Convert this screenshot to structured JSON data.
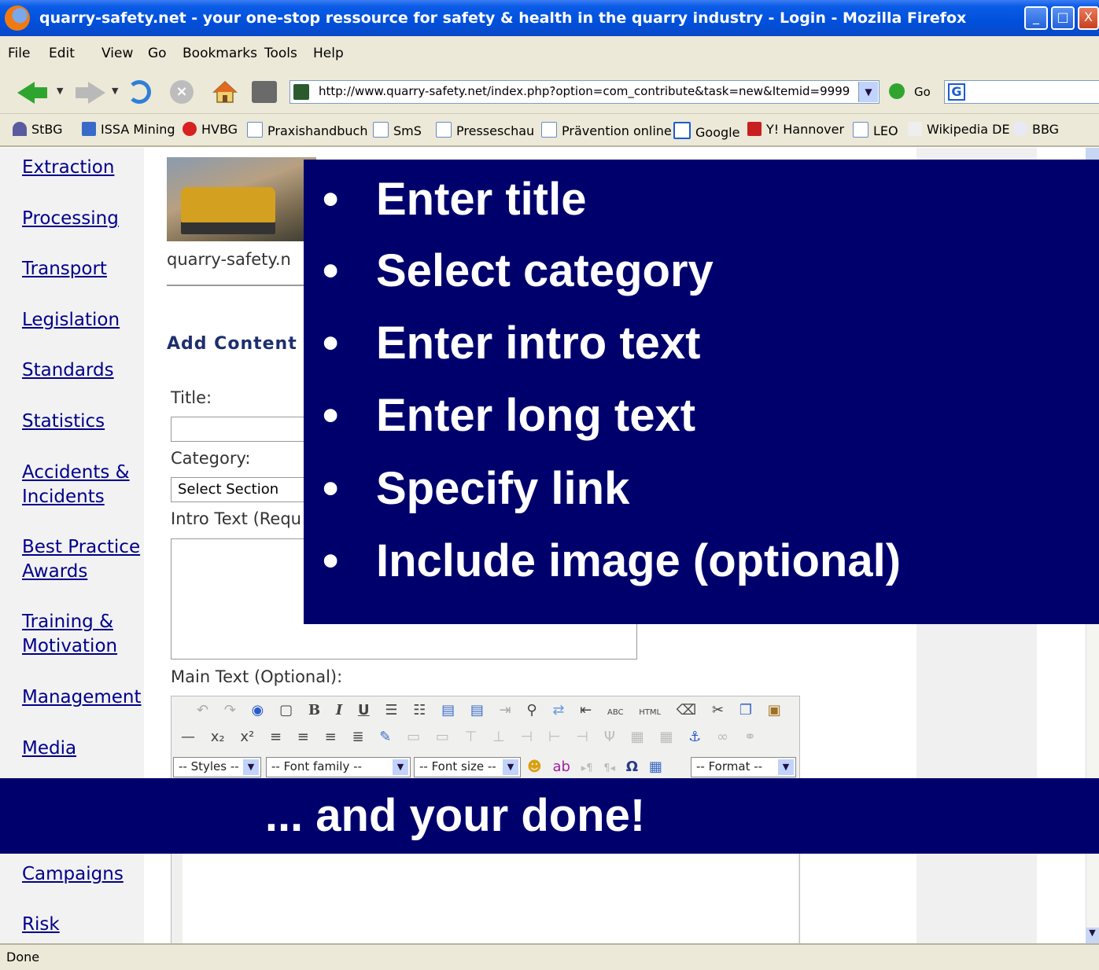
{
  "window": {
    "title": "quarry-safety.net - your one-stop ressource for safety & health in the quarry industry - Login - Mozilla Firefox",
    "minimize": "_",
    "maximize": "□",
    "close": "X"
  },
  "menu": [
    "File",
    "Edit",
    "View",
    "Go",
    "Bookmarks",
    "Tools",
    "Help"
  ],
  "toolbar": {
    "url": "http://www.quarry-safety.net/index.php?option=com_contribute&task=new&Itemid=9999",
    "go_label": "Go",
    "google_letter": "G"
  },
  "bookmarks": [
    "StBG",
    "ISSA Mining",
    "HVBG",
    "Praxishandbuch",
    "SmS",
    "Presseschau",
    "Prävention online",
    "Google",
    "Y! Hannover",
    "LEO",
    "Wikipedia DE",
    "BBG"
  ],
  "sidebar": [
    "Extraction",
    "Processing",
    "Transport",
    "Legislation",
    "Standards",
    "Statistics",
    "Accidents &",
    "Incidents",
    "Best Practice",
    "Awards",
    "Training &",
    "Motivation",
    "Management",
    "Media",
    "Campaigns",
    "Risk"
  ],
  "page": {
    "site_name": "quarry-safety.n",
    "add_content": "Add Content",
    "title_label": "Title:",
    "category_label": "Category:",
    "category_value": "Select Section",
    "intro_label": "Intro Text (Requ",
    "main_label": "Main Text (Optional):"
  },
  "editor": {
    "styles": "-- Styles --",
    "font_family": "-- Font family --",
    "font_size": "-- Font size --",
    "format": "-- Format --"
  },
  "overlay": {
    "bullets": [
      "Enter title",
      "Select category",
      "Enter intro text",
      "Enter long text",
      "Specify link",
      "Include image (optional)"
    ],
    "banner": "... and your done!"
  },
  "status": "Done"
}
